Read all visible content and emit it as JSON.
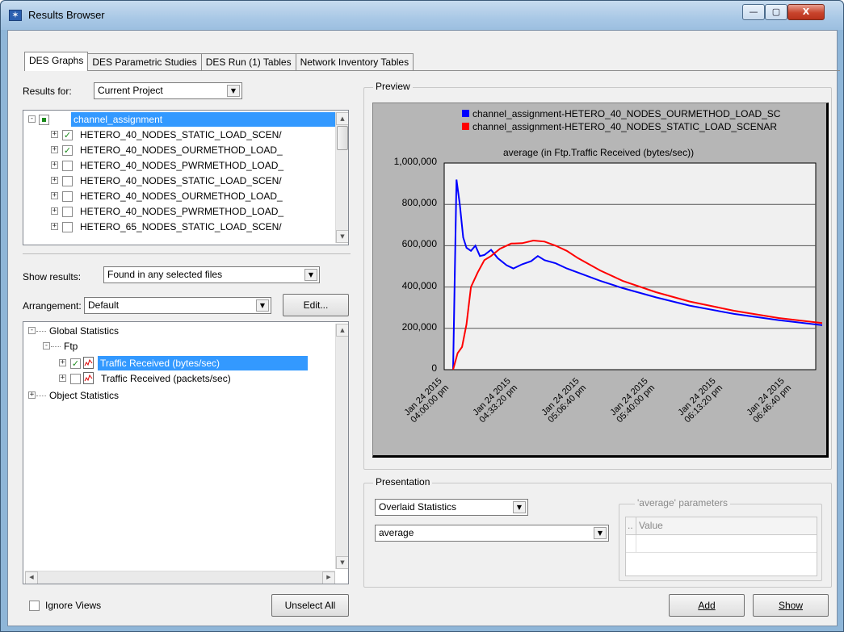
{
  "window": {
    "title": "Results Browser",
    "minimize": "—",
    "maximize": "▢",
    "close": "X"
  },
  "tabs": [
    {
      "label": "DES Graphs",
      "active": true
    },
    {
      "label": "DES Parametric Studies",
      "active": false
    },
    {
      "label": "DES Run (1) Tables",
      "active": false
    },
    {
      "label": "Network Inventory Tables",
      "active": false
    }
  ],
  "results_for": {
    "label": "Results for:",
    "value": "Current Project"
  },
  "files_tree": {
    "root": "channel_assignment",
    "items": [
      {
        "label": "HETERO_40_NODES_STATIC_LOAD_SCEN/",
        "checked": true
      },
      {
        "label": "HETERO_40_NODES_OURMETHOD_LOAD_",
        "checked": true
      },
      {
        "label": "HETERO_40_NODES_PWRMETHOD_LOAD_",
        "checked": false
      },
      {
        "label": "HETERO_40_NODES_STATIC_LOAD_SCEN/",
        "checked": false
      },
      {
        "label": "HETERO_40_NODES_OURMETHOD_LOAD_",
        "checked": false
      },
      {
        "label": "HETERO_40_NODES_PWRMETHOD_LOAD_",
        "checked": false
      },
      {
        "label": "HETERO_65_NODES_STATIC_LOAD_SCEN/",
        "checked": false
      }
    ]
  },
  "show_results": {
    "label": "Show results:",
    "value": "Found in any selected files"
  },
  "arrangement": {
    "label": "Arrangement:",
    "value": "Default",
    "edit_button": "Edit..."
  },
  "stats_tree": {
    "global": "Global Statistics",
    "ftp": "Ftp",
    "stat1": "Traffic Received (bytes/sec)",
    "stat2": "Traffic Received (packets/sec)",
    "object": "Object Statistics"
  },
  "ignore_views": "Ignore Views",
  "unselect_all": "Unselect All",
  "preview": {
    "group_title": "Preview",
    "legend": [
      {
        "name": "channel_assignment-HETERO_40_NODES_OURMETHOD_LOAD_SC",
        "color": "#0000ff"
      },
      {
        "name": "channel_assignment-HETERO_40_NODES_STATIC_LOAD_SCENAR",
        "color": "#ff0000"
      }
    ]
  },
  "chart_data": {
    "type": "line",
    "title": "average (in Ftp.Traffic Received (bytes/sec))",
    "ylim": [
      0,
      1000000
    ],
    "y_ticks": [
      "0",
      "200,000",
      "400,000",
      "600,000",
      "800,000",
      "1,000,000"
    ],
    "x_tick_labels": [
      [
        "Jan 24 2015",
        "04:00:00 pm"
      ],
      [
        "Jan 24 2015",
        "04:33:20 pm"
      ],
      [
        "Jan 24 2015",
        "05:06:40 pm"
      ],
      [
        "Jan 24 2015",
        "05:40:00 pm"
      ],
      [
        "Jan 24 2015",
        "06:13:20 pm"
      ],
      [
        "Jan 24 2015",
        "06:46:40 pm"
      ]
    ],
    "grid": true,
    "series": [
      {
        "name": "channel_assignment-HETERO_40_NODES_OURMETHOD_LOAD_SC",
        "color": "#0000ff",
        "points": [
          [
            "16:04:00",
            0
          ],
          [
            "16:05:30",
            920000
          ],
          [
            "16:07:00",
            800000
          ],
          [
            "16:08:30",
            640000
          ],
          [
            "16:10:00",
            590000
          ],
          [
            "16:12:00",
            575000
          ],
          [
            "16:14:00",
            600000
          ],
          [
            "16:16:00",
            550000
          ],
          [
            "16:18:00",
            555000
          ],
          [
            "16:21:00",
            580000
          ],
          [
            "16:24:00",
            540000
          ],
          [
            "16:28:00",
            505000
          ],
          [
            "16:31:00",
            490000
          ],
          [
            "16:35:00",
            510000
          ],
          [
            "16:39:00",
            525000
          ],
          [
            "16:42:00",
            550000
          ],
          [
            "16:45:00",
            530000
          ],
          [
            "16:50:00",
            515000
          ],
          [
            "16:55:00",
            490000
          ],
          [
            "17:00:00",
            470000
          ],
          [
            "17:10:00",
            430000
          ],
          [
            "17:20:00",
            395000
          ],
          [
            "17:35:00",
            350000
          ],
          [
            "17:50:00",
            310000
          ],
          [
            "18:10:00",
            270000
          ],
          [
            "18:30:00",
            240000
          ],
          [
            "18:50:00",
            215000
          ],
          [
            "19:05:00",
            200000
          ]
        ]
      },
      {
        "name": "channel_assignment-HETERO_40_NODES_STATIC_LOAD_SCENAR",
        "color": "#ff0000",
        "points": [
          [
            "16:04:00",
            0
          ],
          [
            "16:06:00",
            80000
          ],
          [
            "16:08:00",
            110000
          ],
          [
            "16:10:00",
            220000
          ],
          [
            "16:12:00",
            400000
          ],
          [
            "16:15:00",
            470000
          ],
          [
            "16:18:00",
            530000
          ],
          [
            "16:21:00",
            550000
          ],
          [
            "16:25:00",
            585000
          ],
          [
            "16:30:00",
            610000
          ],
          [
            "16:35:00",
            612000
          ],
          [
            "16:40:00",
            625000
          ],
          [
            "16:45:00",
            620000
          ],
          [
            "16:50:00",
            600000
          ],
          [
            "16:55:00",
            575000
          ],
          [
            "17:00:00",
            540000
          ],
          [
            "17:10:00",
            480000
          ],
          [
            "17:20:00",
            430000
          ],
          [
            "17:35:00",
            375000
          ],
          [
            "17:50:00",
            330000
          ],
          [
            "18:10:00",
            285000
          ],
          [
            "18:30:00",
            250000
          ],
          [
            "18:50:00",
            225000
          ],
          [
            "19:05:00",
            210000
          ]
        ]
      }
    ]
  },
  "presentation": {
    "group_title": "Presentation",
    "mode": "Overlaid Statistics",
    "filter": "average",
    "params_title": "'average' parameters",
    "params_col1": "..",
    "params_col2": "Value"
  },
  "add_button": "Add",
  "show_button": "Show"
}
